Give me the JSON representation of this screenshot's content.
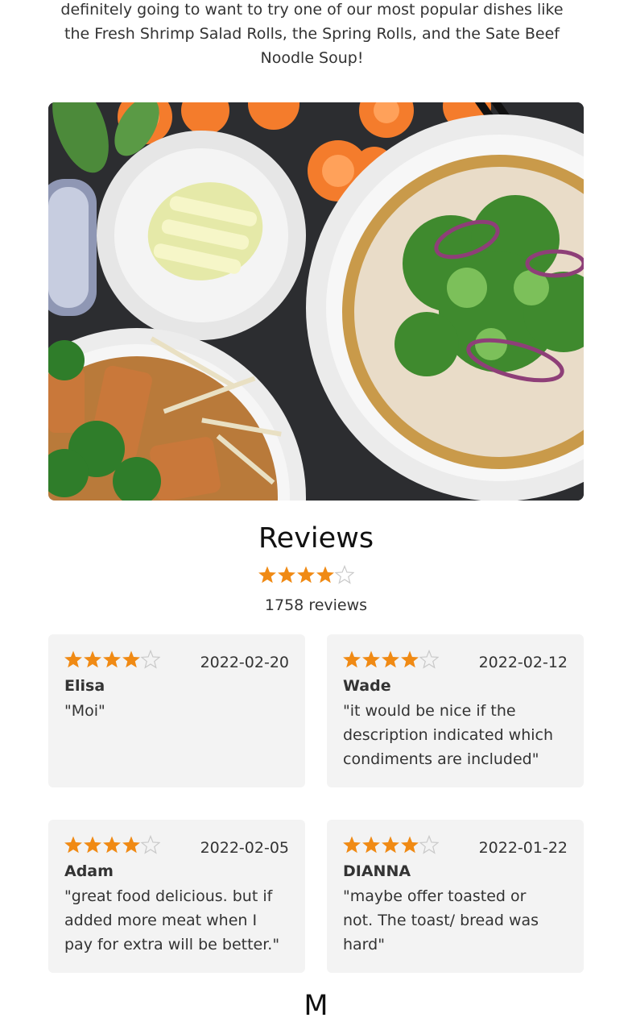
{
  "intro": {
    "text": "definitely going to want to try one of our most popular dishes like the Fresh Shrimp Salad Rolls, the Spring Rolls, and the Sate Beef Noodle Soup!"
  },
  "photo": {
    "description_icon": "food-photo"
  },
  "reviews": {
    "title": "Reviews",
    "summary_rating": 4,
    "summary_max": 5,
    "count_text": "1758 reviews",
    "items": [
      {
        "rating": 4,
        "date": "2022-02-20",
        "name": "Elisa",
        "text": "\"Moi\""
      },
      {
        "rating": 4,
        "date": "2022-02-12",
        "name": "Wade",
        "text": "\"it would be nice if the description indicated which condiments are included\""
      },
      {
        "rating": 4,
        "date": "2022-02-05",
        "name": "Adam",
        "text": "\"great food delicious. but if added more meat when I pay for extra will be better.\""
      },
      {
        "rating": 4,
        "date": "2022-01-22",
        "name": "DIANNA",
        "text": "\"maybe offer toasted or not. The toast/ bread was hard\""
      }
    ]
  },
  "next_section": {
    "title": "M"
  },
  "colors": {
    "star_filled": "#f08a14",
    "star_empty_stroke": "#c9c9c9",
    "card_bg": "#f3f3f3"
  }
}
